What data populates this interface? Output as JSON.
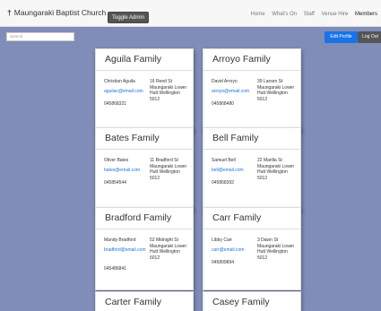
{
  "header": {
    "brand": "Maungaraki Baptist Church",
    "toggle_label": "Toggle Admin",
    "nav": [
      "Home",
      "What's On",
      "Staff",
      "Venue Hire",
      "Members"
    ]
  },
  "toolbar": {
    "search_placeholder": "Search",
    "edit_profile": "Edit Profile",
    "logout": "Log Out"
  },
  "families": [
    {
      "title": "Aguila Family",
      "name": "Christian Aguila",
      "email": "aguilac@email.com",
      "phone": "045868321",
      "address": "16 Reed St Maungaraki Lower Hutt Wellington 5012"
    },
    {
      "title": "Arroyo Family",
      "name": "David Arroyo",
      "email": "arroyo@email.com",
      "phone": "045868480",
      "address": "39 Larsen St Maungaraki Lower Hutt Wellington 5012"
    },
    {
      "title": "Bates Family",
      "name": "Oliver Bates",
      "email": "bates@email.com",
      "phone": "045854544",
      "address": "11 Bradford St Maungaraki Lower Hutt Wellington 5012"
    },
    {
      "title": "Bell Family",
      "name": "Samuel Bell",
      "email": "bell@email.com",
      "phone": "045868392",
      "address": "22 Marilla St Maungaraki Lower Hutt Wellington 5012"
    },
    {
      "title": "Bradford Family",
      "name": "Mandy Bradford",
      "email": "bradford@email.com",
      "phone": "045486841",
      "address": "52 Midnight St Maungaraki Lower Hutt Wellington 5012"
    },
    {
      "title": "Carr Family",
      "name": "Libby Carr",
      "email": "carr@email.com",
      "phone": "045899894",
      "address": "3 Dawn St Maungaraki Lower Hutt Wellington 5012"
    },
    {
      "title": "Carter Family"
    },
    {
      "title": "Casey Family"
    }
  ]
}
